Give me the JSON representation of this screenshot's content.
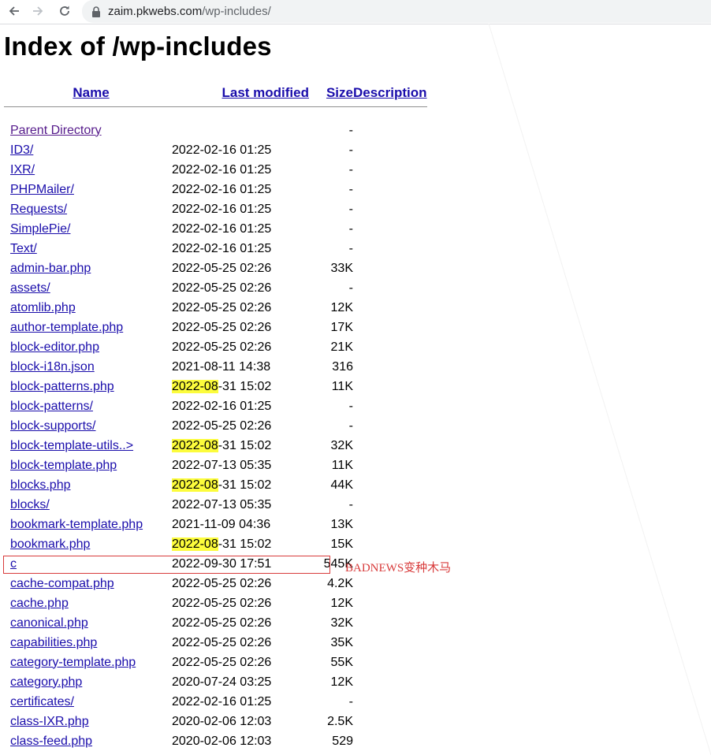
{
  "browser": {
    "url_host": "zaim.pkwebs.com",
    "url_path": "/wp-includes/"
  },
  "page": {
    "title": "Index of /wp-includes"
  },
  "table": {
    "headers": {
      "name": "Name",
      "last_modified": "Last modified",
      "size": "Size",
      "description": "Description"
    },
    "rows": [
      {
        "name": "Parent Directory",
        "date": "",
        "size": "-",
        "visited": true,
        "highlight": false
      },
      {
        "name": "ID3/",
        "date": "2022-02-16 01:25",
        "size": "-",
        "visited": false,
        "highlight": false
      },
      {
        "name": "IXR/",
        "date": "2022-02-16 01:25",
        "size": "-",
        "visited": false,
        "highlight": false
      },
      {
        "name": "PHPMailer/",
        "date": "2022-02-16 01:25",
        "size": "-",
        "visited": false,
        "highlight": false
      },
      {
        "name": "Requests/",
        "date": "2022-02-16 01:25",
        "size": "-",
        "visited": false,
        "highlight": false
      },
      {
        "name": "SimplePie/",
        "date": "2022-02-16 01:25",
        "size": "-",
        "visited": false,
        "highlight": false
      },
      {
        "name": "Text/",
        "date": "2022-02-16 01:25",
        "size": "-",
        "visited": false,
        "highlight": false
      },
      {
        "name": "admin-bar.php",
        "date": "2022-05-25 02:26",
        "size": "33K",
        "visited": false,
        "highlight": false
      },
      {
        "name": "assets/",
        "date": "2022-05-25 02:26",
        "size": "-",
        "visited": false,
        "highlight": false
      },
      {
        "name": "atomlib.php",
        "date": "2022-05-25 02:26",
        "size": "12K",
        "visited": false,
        "highlight": false
      },
      {
        "name": "author-template.php",
        "date": "2022-05-25 02:26",
        "size": "17K",
        "visited": false,
        "highlight": false
      },
      {
        "name": "block-editor.php",
        "date": "2022-05-25 02:26",
        "size": "21K",
        "visited": false,
        "highlight": false
      },
      {
        "name": "block-i18n.json",
        "date": "2021-08-11 14:38",
        "size": "316",
        "visited": false,
        "highlight": false
      },
      {
        "name": "block-patterns.php",
        "date": "2022-08-31 15:02",
        "size": "11K",
        "visited": false,
        "highlight": true
      },
      {
        "name": "block-patterns/",
        "date": "2022-02-16 01:25",
        "size": "-",
        "visited": false,
        "highlight": false
      },
      {
        "name": "block-supports/",
        "date": "2022-05-25 02:26",
        "size": "-",
        "visited": false,
        "highlight": false
      },
      {
        "name": "block-template-utils..>",
        "date": "2022-08-31 15:02",
        "size": "32K",
        "visited": false,
        "highlight": true
      },
      {
        "name": "block-template.php",
        "date": "2022-07-13 05:35",
        "size": "11K",
        "visited": false,
        "highlight": false
      },
      {
        "name": "blocks.php",
        "date": "2022-08-31 15:02",
        "size": "44K",
        "visited": false,
        "highlight": true
      },
      {
        "name": "blocks/",
        "date": "2022-07-13 05:35",
        "size": "-",
        "visited": false,
        "highlight": false
      },
      {
        "name": "bookmark-template.php",
        "date": "2021-11-09 04:36",
        "size": "13K",
        "visited": false,
        "highlight": false
      },
      {
        "name": "bookmark.php",
        "date": "2022-08-31 15:02",
        "size": "15K",
        "visited": false,
        "highlight": true
      },
      {
        "name": "c",
        "date": "2022-09-30 17:51",
        "size": "545K",
        "visited": false,
        "highlight": false
      },
      {
        "name": "cache-compat.php",
        "date": "2022-05-25 02:26",
        "size": "4.2K",
        "visited": false,
        "highlight": false
      },
      {
        "name": "cache.php",
        "date": "2022-05-25 02:26",
        "size": "12K",
        "visited": false,
        "highlight": false
      },
      {
        "name": "canonical.php",
        "date": "2022-05-25 02:26",
        "size": "32K",
        "visited": false,
        "highlight": false
      },
      {
        "name": "capabilities.php",
        "date": "2022-05-25 02:26",
        "size": "35K",
        "visited": false,
        "highlight": false
      },
      {
        "name": "category-template.php",
        "date": "2022-05-25 02:26",
        "size": "55K",
        "visited": false,
        "highlight": false
      },
      {
        "name": "category.php",
        "date": "2020-07-24 03:25",
        "size": "12K",
        "visited": false,
        "highlight": false
      },
      {
        "name": "certificates/",
        "date": "2022-02-16 01:25",
        "size": "-",
        "visited": false,
        "highlight": false
      },
      {
        "name": "class-IXR.php",
        "date": "2020-02-06 12:03",
        "size": "2.5K",
        "visited": false,
        "highlight": false
      },
      {
        "name": "class-feed.php",
        "date": "2020-02-06 12:03",
        "size": "529",
        "visited": false,
        "highlight": false
      }
    ]
  },
  "annotation": {
    "label": "BADNEWS变种木马",
    "color": "#d83b3b"
  },
  "colors": {
    "link": "#1a0dab",
    "visited": "#551a8b",
    "highlight": "#fcfc3c"
  }
}
